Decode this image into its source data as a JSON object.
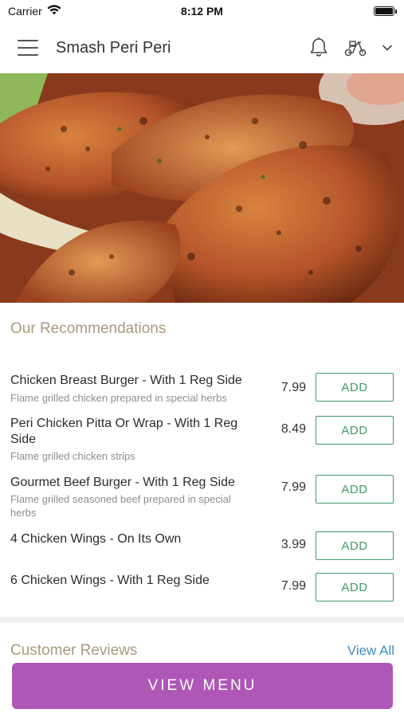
{
  "status_bar": {
    "carrier": "Carrier",
    "time": "8:12 PM"
  },
  "header": {
    "title": "Smash Peri Peri",
    "icons": [
      "menu-icon",
      "bell-icon",
      "scooter-icon",
      "chevron-down-icon"
    ]
  },
  "recommendations": {
    "title": "Our Recommendations",
    "add_label": "ADD",
    "items": [
      {
        "name": "Chicken Breast Burger - With 1 Reg Side",
        "description": "Flame grilled chicken prepared in special herbs",
        "price": "7.99"
      },
      {
        "name": "Peri Chicken Pitta Or Wrap - With 1 Reg Side",
        "description": "Flame grilled chicken strips",
        "price": "8.49"
      },
      {
        "name": "Gourmet Beef Burger - With 1 Reg Side",
        "description": "Flame grilled seasoned beef prepared in special herbs",
        "price": "7.99"
      },
      {
        "name": "4 Chicken Wings - On Its Own",
        "description": "",
        "price": "3.99"
      },
      {
        "name": "6 Chicken Wings - With 1 Reg Side",
        "description": "",
        "price": "7.99"
      }
    ]
  },
  "reviews": {
    "title": "Customer Reviews",
    "view_all": "View All"
  },
  "footer": {
    "view_menu": "VIEW MENU"
  },
  "colors": {
    "accent_purple": "#ae57b6",
    "add_green": "#3f9a67",
    "section_title": "#a99a7c",
    "link_blue": "#3e8fbf"
  }
}
